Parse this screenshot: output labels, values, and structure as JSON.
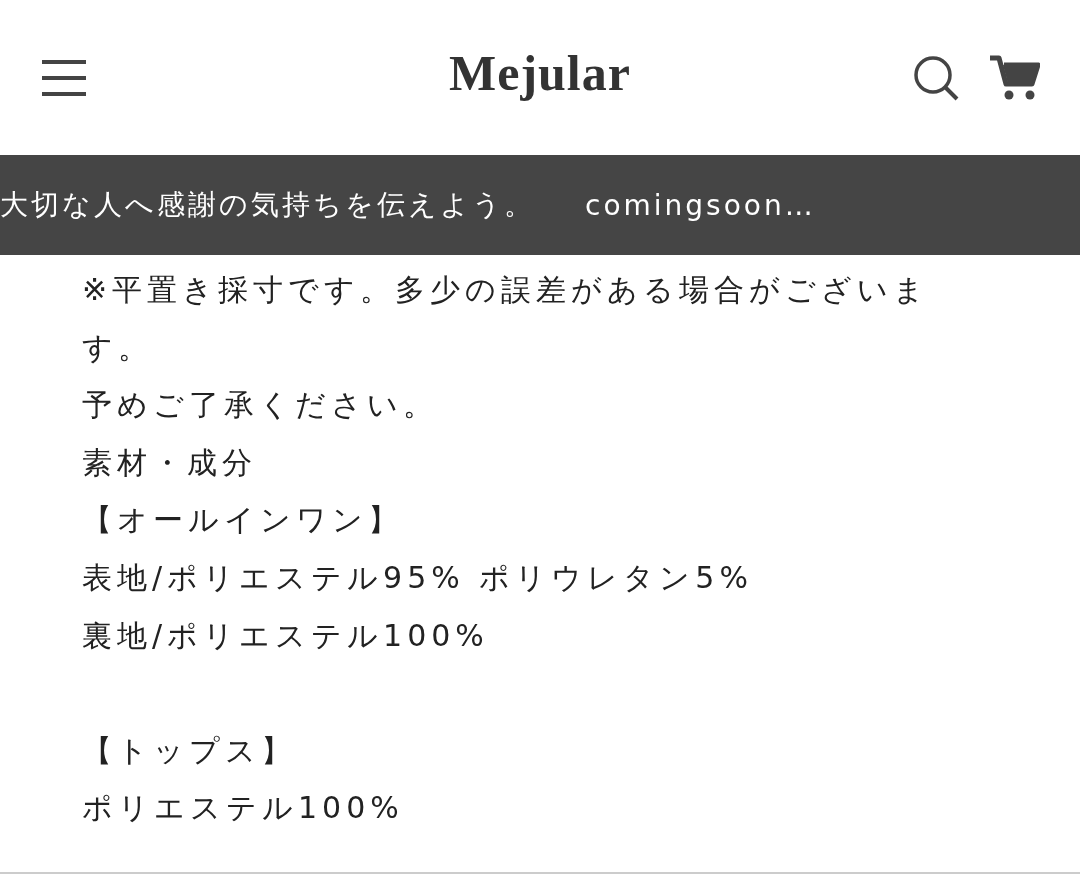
{
  "header": {
    "logo": "Mejular"
  },
  "banner": {
    "messages": [
      "大切な人へ感謝の気持ちを伝えよう。",
      "comingsoon…"
    ]
  },
  "description": {
    "blocks": [
      [
        "※平置き採寸です。多少の誤差がある場合がございま",
        "す。",
        "予めご了承ください。",
        "素材・成分",
        "【オールインワン】",
        "表地/ポリエステル95% ポリウレタン5%",
        "裏地/ポリエステル100%"
      ],
      [
        "【トップス】",
        "ポリエステル100%"
      ]
    ]
  }
}
